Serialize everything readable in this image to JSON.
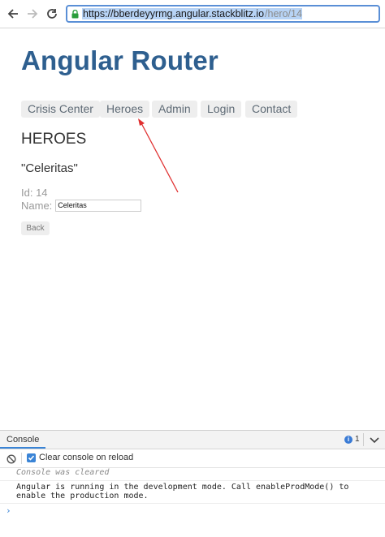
{
  "browser": {
    "url_selected": "https://bberdeyyrmg.angular.stackblitz.io",
    "url_path": "/hero/14",
    "icons": [
      "back-arrow-icon",
      "forward-arrow-icon",
      "reload-icon",
      "lock-icon"
    ]
  },
  "app": {
    "title": "Angular Router",
    "nav": [
      "Crisis Center",
      "Heroes",
      "Admin",
      "Login",
      "Contact"
    ]
  },
  "hero": {
    "section_title": "HEROES",
    "name_display": "\"Celeritas\"",
    "id_text": "Id: 14",
    "name_label": "Name:",
    "name_value": "Celeritas",
    "back_label": "Back"
  },
  "annotation": {
    "color": "#e03030"
  },
  "console": {
    "tab_label": "Console",
    "info_count": "1",
    "clear_on_reload_label": "Clear console on reload",
    "cleared_msg": "Console was cleared",
    "log_msg": "Angular is running in the development mode. Call enableProdMode() to enable the production mode.",
    "prompt": "›"
  },
  "colors": {
    "title": "#2e5f8f",
    "accent": "#3a84d6"
  }
}
